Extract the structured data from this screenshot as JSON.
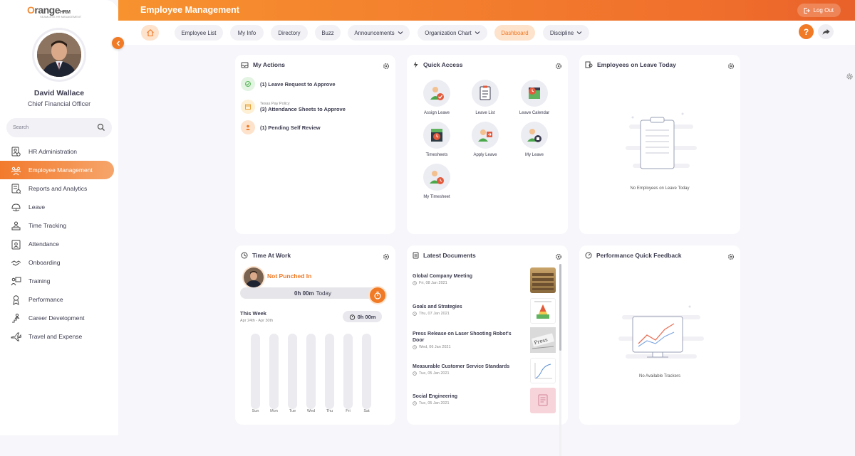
{
  "brand": {
    "logo_main": "range",
    "logo_o": "O",
    "logo_hrm": "HRM",
    "logo_sub": "SEAMLESS HR MANAGEMENT"
  },
  "profile": {
    "name": "David Wallace",
    "title": "Chief Financial Officer"
  },
  "search": {
    "placeholder": "Search"
  },
  "sidebar": {
    "items": [
      {
        "label": "HR Administration",
        "icon": "hr-admin-icon"
      },
      {
        "label": "Employee Management",
        "icon": "employee-management-icon",
        "active": true
      },
      {
        "label": "Reports and Analytics",
        "icon": "reports-icon"
      },
      {
        "label": "Leave",
        "icon": "leave-icon"
      },
      {
        "label": "Time Tracking",
        "icon": "time-tracking-icon"
      },
      {
        "label": "Attendance",
        "icon": "attendance-icon"
      },
      {
        "label": "Onboarding",
        "icon": "onboarding-icon"
      },
      {
        "label": "Training",
        "icon": "training-icon"
      },
      {
        "label": "Performance",
        "icon": "performance-icon"
      },
      {
        "label": "Career Development",
        "icon": "career-icon"
      },
      {
        "label": "Travel and Expense",
        "icon": "travel-icon"
      }
    ]
  },
  "header": {
    "title": "Employee Management",
    "logout": "Log Out"
  },
  "nav": {
    "tabs": [
      {
        "label": "Employee List"
      },
      {
        "label": "My Info"
      },
      {
        "label": "Directory"
      },
      {
        "label": "Buzz"
      },
      {
        "label": "Announcements",
        "dropdown": true
      },
      {
        "label": "Organization Chart",
        "dropdown": true
      },
      {
        "label": "Dashboard",
        "active": true
      },
      {
        "label": "Discipline",
        "dropdown": true
      }
    ],
    "help": "?"
  },
  "my_actions": {
    "title": "My Actions",
    "items": [
      {
        "text": "(1) Leave Request to Approve",
        "sub": ""
      },
      {
        "text": "(3) Attendance Sheets to Approve",
        "sub": "Texas Pay Policy"
      },
      {
        "text": "(1) Pending Self Review",
        "sub": ""
      }
    ]
  },
  "quick_access": {
    "title": "Quick Access",
    "items": [
      {
        "label": "Assign Leave"
      },
      {
        "label": "Leave List"
      },
      {
        "label": "Leave Calendar"
      },
      {
        "label": "Timesheets"
      },
      {
        "label": "Apply Leave"
      },
      {
        "label": "My Leave"
      },
      {
        "label": "My Timesheet"
      }
    ]
  },
  "on_leave": {
    "title": "Employees on Leave Today",
    "empty": "No Employees on Leave Today"
  },
  "time_at_work": {
    "title": "Time At Work",
    "status": "Not Punched In",
    "today_value": "0h 00m",
    "today_label": "Today",
    "week_label": "This Week",
    "week_range": "Apr 24th - Apr 30th",
    "week_total": "0h 00m",
    "days": [
      "Sun",
      "Mon",
      "Tue",
      "Wed",
      "Thu",
      "Fri",
      "Sat"
    ]
  },
  "documents": {
    "title": "Latest Documents",
    "items": [
      {
        "title": "Global Company Meeting",
        "date": "Fri, 08 Jan 2021"
      },
      {
        "title": "Goals and Strategies",
        "date": "Thu, 07 Jan 2021"
      },
      {
        "title": "Press Release on Laser Shooting Robot's Door",
        "date": "Wed, 06 Jan 2021"
      },
      {
        "title": "Measurable Customer Service Standards",
        "date": "Tue, 05 Jan 2021"
      },
      {
        "title": "Social Engineering",
        "date": "Tue, 05 Jan 2021"
      }
    ]
  },
  "feedback": {
    "title": "Performance Quick Feedback",
    "empty": "No Available Trackers"
  },
  "colors": {
    "accent": "#f07a26",
    "accent_light": "#fde2cc",
    "bg": "#f6f6fb"
  }
}
